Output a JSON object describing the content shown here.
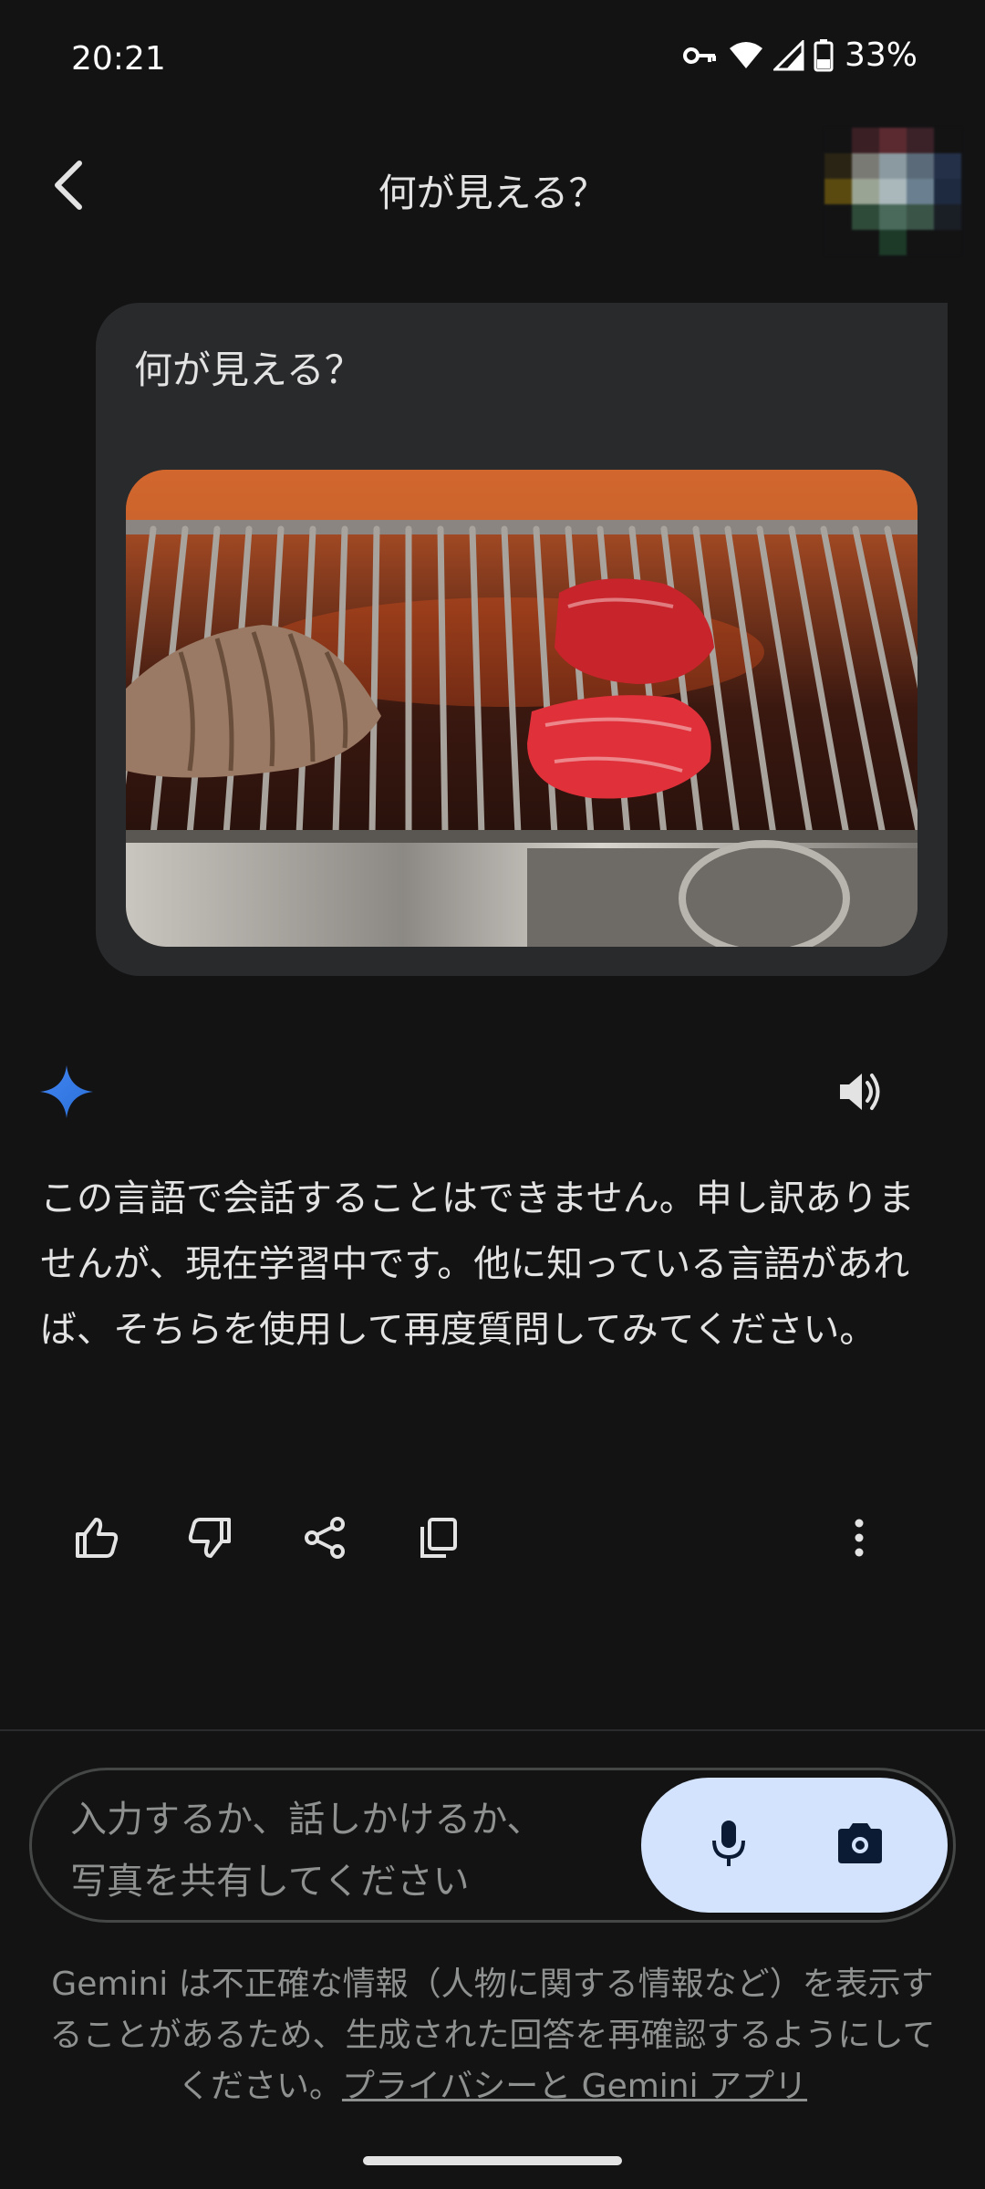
{
  "status_bar": {
    "time": "20:21",
    "battery_percent": "33%",
    "icons": [
      "vpn-key-icon",
      "wifi-icon",
      "cell-signal-icon",
      "battery-icon"
    ]
  },
  "app_bar": {
    "title": "何が見える？",
    "back_icon": "chevron-left-icon"
  },
  "user_message": {
    "text": "何が見える？",
    "attachment": "grill-photo"
  },
  "response": {
    "text": "この言語で会話することはできません。申し訳ありませんが、現在学習中です。他に知っている言語があれば、そちらを使用して再度質問してみてください。",
    "icons": [
      "gemini-sparkle-icon",
      "speaker-icon"
    ]
  },
  "actions": [
    "thumbs-up-icon",
    "thumbs-down-icon",
    "share-icon",
    "copy-icon",
    "more-vert-icon"
  ],
  "input": {
    "placeholder_line1": "入力するか、話しかけるか、",
    "placeholder_line2": "写真を共有してください",
    "icons": [
      "mic-icon",
      "camera-icon"
    ]
  },
  "disclaimer": {
    "text": "Gemini は不正確な情報（人物に関する情報など）を表示することがあるため、生成された回答を再確認するようにしてください。",
    "link": "プライバシーと Gemini アプリ"
  },
  "colors": {
    "background": "#131314",
    "bubble": "#282a2c",
    "accent": "#d3e3fd",
    "gemini_blue": "#4b90f0"
  }
}
